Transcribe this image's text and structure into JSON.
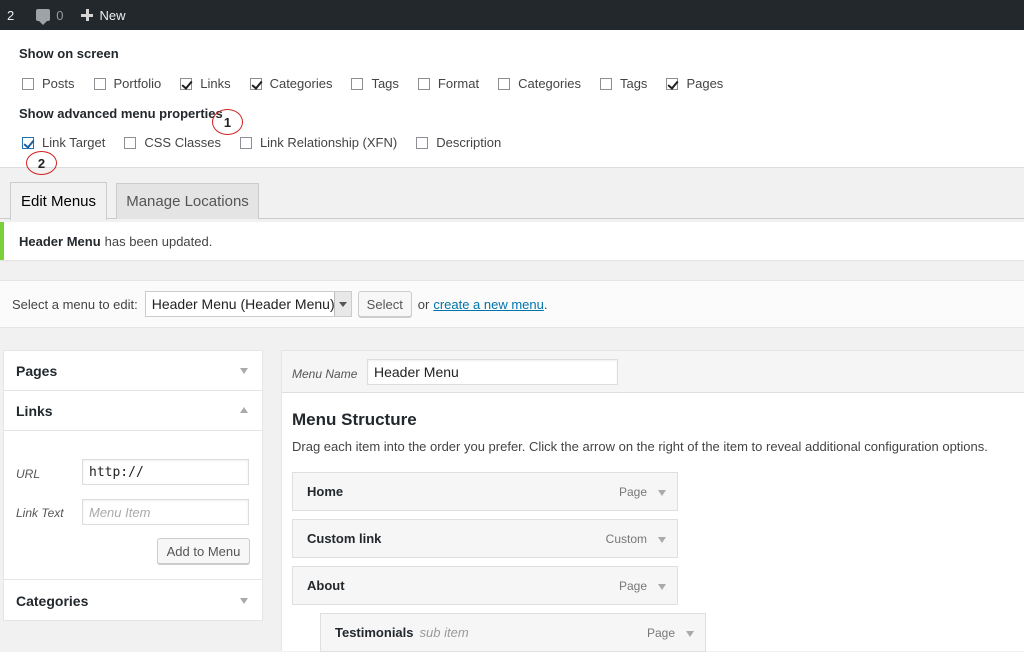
{
  "adminbar": {
    "updates_count": "2",
    "comments_count": "0",
    "new_label": "New"
  },
  "screen_options": {
    "show_on_screen_label": "Show on screen",
    "boxes": [
      {
        "label": "Posts",
        "checked": false
      },
      {
        "label": "Portfolio",
        "checked": false
      },
      {
        "label": "Links",
        "checked": true
      },
      {
        "label": "Categories",
        "checked": true
      },
      {
        "label": "Tags",
        "checked": false
      },
      {
        "label": "Format",
        "checked": false
      },
      {
        "label": "Categories",
        "checked": false
      },
      {
        "label": "Tags",
        "checked": false
      },
      {
        "label": "Pages",
        "checked": true
      }
    ],
    "advanced_label": "Show advanced menu properties",
    "advanced": [
      {
        "label": "Link Target",
        "checked": true
      },
      {
        "label": "CSS Classes",
        "checked": false
      },
      {
        "label": "Link Relationship (XFN)",
        "checked": false
      },
      {
        "label": "Description",
        "checked": false
      }
    ],
    "callout_1": "1",
    "callout_2": "2"
  },
  "tabs": {
    "edit_menus": "Edit Menus",
    "manage_locations": "Manage Locations"
  },
  "notice": {
    "menu_name": "Header Menu",
    "message": "has been updated."
  },
  "manage": {
    "label": "Select a menu to edit:",
    "selected": "Header Menu (Header Menu)",
    "select_button": "Select",
    "or_text": "or",
    "create_link": "create a new menu",
    "period": "."
  },
  "accordion": {
    "pages_title": "Pages",
    "links_title": "Links",
    "url_label": "URL",
    "url_value": "http://",
    "link_text_label": "Link Text",
    "link_text_placeholder": "Menu Item",
    "add_button": "Add to Menu",
    "categories_title": "Categories"
  },
  "menu": {
    "name_label": "Menu Name",
    "name_value": "Header Menu",
    "structure_title": "Menu Structure",
    "structure_desc": "Drag each item into the order you prefer. Click the arrow on the right of the item to reveal additional configuration options.",
    "items": [
      {
        "title": "Home",
        "type": "Page",
        "sub": ""
      },
      {
        "title": "Custom link",
        "type": "Custom",
        "sub": ""
      },
      {
        "title": "About",
        "type": "Page",
        "sub": ""
      },
      {
        "title": "Testimonials",
        "type": "Page",
        "sub": "sub item"
      }
    ]
  }
}
